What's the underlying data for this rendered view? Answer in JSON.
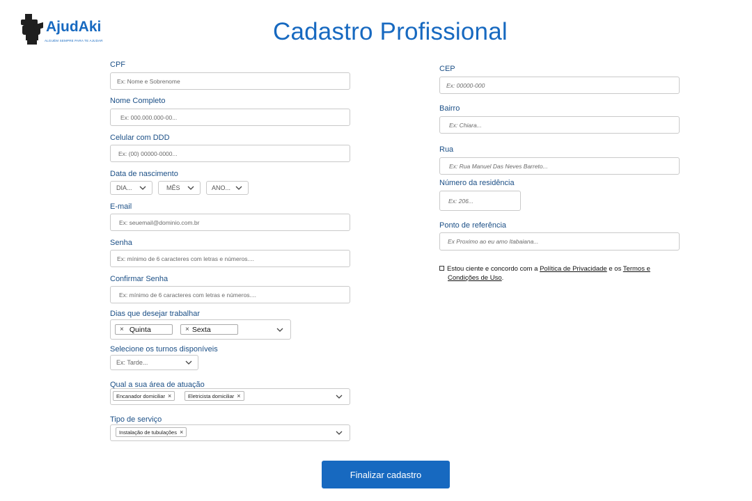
{
  "logo": {
    "name": "AjudAki",
    "tagline": "ALGUÉM SEMPRE PARA TE AJUDAR"
  },
  "page_title": "Cadastro Profissional",
  "left": {
    "cpf": {
      "label": "CPF",
      "placeholder": "Ex: Nome e Sobrenome"
    },
    "nome": {
      "label": "Nome Completo",
      "placeholder": "Ex: 000.000.000-00..."
    },
    "celular": {
      "label": "Celular com DDD",
      "placeholder": "Ex: (00) 00000-0000..."
    },
    "nascimento": {
      "label": "Data de nascimento",
      "dia": "DIA...",
      "mes": "MÊS",
      "ano": "ANO..."
    },
    "email": {
      "label": "E-mail",
      "placeholder": "Ex: seuemail@dominio.com.br"
    },
    "senha": {
      "label": "Senha",
      "placeholder": "Ex: mínimo de 6 caracteres com letras e números...."
    },
    "confirmar": {
      "label": "Confirmar Senha",
      "placeholder": "Ex: mínimo de 6 caracteres com letras e números...."
    },
    "dias": {
      "label": "Dias que desejar trabalhar",
      "selected": [
        "Quinta",
        "Sexta"
      ]
    },
    "turnos": {
      "label": "Selecione os turnos disponíveis",
      "value": "Ex: Tarde..."
    },
    "area": {
      "label": "Qual a sua área de atuação",
      "selected": [
        "Encanador domiciliar",
        "Eletricista domiciliar"
      ]
    },
    "tipo": {
      "label": "Tipo de serviço",
      "selected": [
        "Instalação de tubulações"
      ]
    }
  },
  "right": {
    "cep": {
      "label": "CEP",
      "placeholder": "Ex: 00000-000"
    },
    "bairro": {
      "label": "Bairro",
      "placeholder": "Ex: Chiara..."
    },
    "rua": {
      "label": "Rua",
      "placeholder": "Ex: Rua Manuel Das Neves Barreto..."
    },
    "numero": {
      "label": "Número da residência",
      "placeholder": "Ex: 206..."
    },
    "referencia": {
      "label": "Ponto de referência",
      "placeholder": "Ex Proximo ao eu amo Itabaiana..."
    }
  },
  "terms": {
    "prefix": "Estou ciente e concordo com a",
    "privacy": "Política de Privacidade",
    "and": "e os",
    "terms1": "Termos e",
    "terms2": "Condições de Uso",
    "suffix": "."
  },
  "submit_label": "Finalizar cadastro",
  "colors": {
    "brand": "#1769c0",
    "label": "#1b4f86"
  },
  "icons": {
    "chevron": "chevron-down-icon",
    "remove": "close-icon",
    "logo": "hand-tool-icon"
  }
}
